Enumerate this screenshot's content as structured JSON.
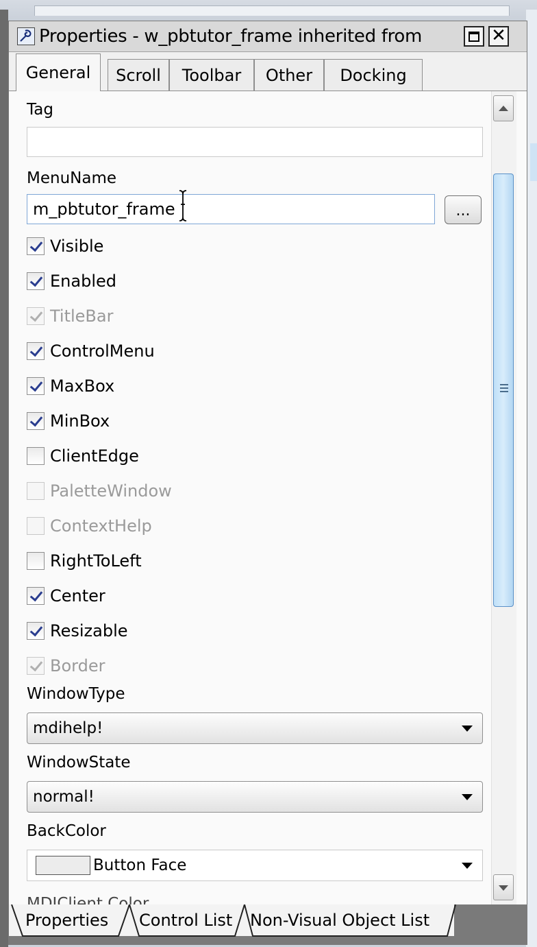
{
  "window": {
    "title": "Properties - w_pbtutor_frame  inherited  from",
    "maximize_glyph": "□",
    "close_glyph": "✕"
  },
  "tabs": [
    {
      "label": "General",
      "active": true
    },
    {
      "label": "Scroll",
      "active": false
    },
    {
      "label": "Toolbar",
      "active": false
    },
    {
      "label": "Other",
      "active": false
    },
    {
      "label": "Docking",
      "active": false
    }
  ],
  "fields": {
    "tag": {
      "label": "Tag",
      "value": ""
    },
    "menuname": {
      "label": "MenuName",
      "value": "m_pbtutor_frame",
      "button_label": "..."
    }
  },
  "checkboxes": [
    {
      "label": "Visible",
      "checked": true,
      "disabled": false
    },
    {
      "label": "Enabled",
      "checked": true,
      "disabled": false
    },
    {
      "label": "TitleBar",
      "checked": true,
      "disabled": true
    },
    {
      "label": "ControlMenu",
      "checked": true,
      "disabled": false
    },
    {
      "label": "MaxBox",
      "checked": true,
      "disabled": false
    },
    {
      "label": "MinBox",
      "checked": true,
      "disabled": false
    },
    {
      "label": "ClientEdge",
      "checked": false,
      "disabled": false
    },
    {
      "label": "PaletteWindow",
      "checked": false,
      "disabled": true
    },
    {
      "label": "ContextHelp",
      "checked": false,
      "disabled": true
    },
    {
      "label": "RightToLeft",
      "checked": false,
      "disabled": false
    },
    {
      "label": "Center",
      "checked": true,
      "disabled": false
    },
    {
      "label": "Resizable",
      "checked": true,
      "disabled": false
    },
    {
      "label": "Border",
      "checked": true,
      "disabled": true
    }
  ],
  "dropdowns": {
    "windowtype": {
      "label": "WindowType",
      "value": "mdihelp!"
    },
    "windowstate": {
      "label": "WindowState",
      "value": "normal!"
    },
    "backcolor": {
      "label": "BackColor",
      "value": "Button Face",
      "swatch_color": "#ececec"
    }
  },
  "cut_off_label": "MDIClient Color",
  "bottom_tabs": [
    {
      "label": "Properties",
      "active": true
    },
    {
      "label": "Control List",
      "active": false
    },
    {
      "label": "Non-Visual Object List",
      "active": false
    }
  ],
  "colors": {
    "check_mark": "#2a3d8f",
    "scroll_thumb": "#bfe0f8",
    "focus_border": "#7ea6d6"
  }
}
